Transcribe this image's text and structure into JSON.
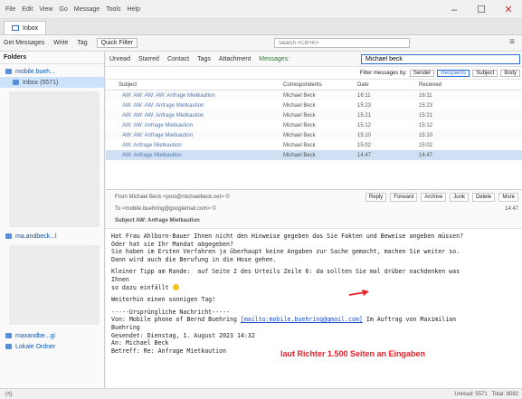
{
  "menu": [
    "File",
    "Edit",
    "View",
    "Go",
    "Message",
    "Tools",
    "Help"
  ],
  "tab": {
    "label": "Inbox"
  },
  "toolbar": {
    "get_messages": "Get Messages",
    "write": "Write",
    "tag": "Tag",
    "quick_filter": "Quick Filter",
    "search_placeholder": "Search <Ctrl+K>"
  },
  "sidebar": {
    "header": "Folders",
    "account1": "mobile.bueh...",
    "inbox": "Inbox (5571)",
    "account2": "ma.andbeck...l",
    "account3": "maxandbe...gi",
    "local": "Lokale Ordner"
  },
  "filterbar": {
    "unread": "Unread",
    "starred": "Starred",
    "contact": "Contact",
    "tags": "Tags",
    "attachment": "Attachment",
    "messages_label": "Messages:",
    "filter_value": "Michael beck",
    "filter_by": "Filter messages by:",
    "sender": "Sender",
    "recipients": "Recipients",
    "subject": "Subject",
    "body": "Body"
  },
  "columns": {
    "subject": "Subject",
    "correspondents": "Correspondents",
    "date": "Date",
    "received": "Received"
  },
  "messages": [
    {
      "subject": "AW: AW: AW: AW: Anfrage Mietkaution",
      "correspondent": "Michael Beck",
      "date": "16:11",
      "received": "16:11"
    },
    {
      "subject": "AW: AW: AW: Anfrage Mietkaution",
      "correspondent": "Michael Beck",
      "date": "15:23",
      "received": "15:23"
    },
    {
      "subject": "AW: AW: AW: Anfrage Mietkaution",
      "correspondent": "Michael Beck",
      "date": "15:21",
      "received": "15:21"
    },
    {
      "subject": "AW: AW: Anfrage Mietkaution",
      "correspondent": "Michael Beck",
      "date": "15:12",
      "received": "15:12"
    },
    {
      "subject": "AW: AW: Anfrage Mietkaution",
      "correspondent": "Michael Beck",
      "date": "15:10",
      "received": "15:10"
    },
    {
      "subject": "AW: Anfrage Mietkaution",
      "correspondent": "Michael Beck",
      "date": "15:02",
      "received": "15:02"
    },
    {
      "subject": "AW: Anfrage Mietkaution",
      "correspondent": "Michael Beck",
      "date": "14:47",
      "received": "14:47"
    }
  ],
  "preview": {
    "from": "From Michael Beck <post@michaelbeck.net> ©",
    "to": "To  <mobile.buehring@googlemail.com> ©",
    "subject": "Subject  AW: Anfrage Mietkaution",
    "date": "14:47",
    "reply": "Reply",
    "forward": "Forward",
    "archive": "Archive",
    "junk": "Junk",
    "delete": "Delete",
    "more": "More"
  },
  "body": {
    "line1": "Hat Frau Ahlborn-Bauer Ihnen nicht den Hinweise gegeben das Sie Fakten und Beweise angeben müssen?",
    "line2": "Oder hat sie Ihr Mandat abgegeben?",
    "line3": "Sie haben im Ersten Verfahren ja überhaupt keine Angaben zur Sache gemacht, machen Sie weiter so.",
    "line4": "Dann wird auch die Berufung in die Hose gehen.",
    "line5": "Kleiner Tipp am Rande:  auf Seite 2 des Urteils Zeile 6: da sollten Sie mal drüber nachdenken was",
    "line6": "Ihnen",
    "line7": "so dazu einfällt",
    "line8": "Weiterhin einen sonnigen Tag!",
    "line9": "-----Ursprüngliche Nachricht-----",
    "line10a": "Von: Mobile phone of Bernd Buehring ",
    "line10link": "[mailto:mobile.buehring@gmail.com]",
    "line10b": " Im Auftrag von Maximilian",
    "line11": "Buehring",
    "line12": "Gesendet: Dienstag, 1. August 2023 14:32",
    "line13": "An: Michael Beck",
    "line14": "Betreff: Re: Anfrage Mietkaution",
    "annotation": "laut Richter 1.500 Seiten an Eingaben"
  },
  "status": {
    "left": "(•|)",
    "unread": "Unread: 5571",
    "total": "Total: 8082"
  },
  "colors": {
    "annotation": "#e4232b",
    "link": "#1a4fc9",
    "selected_row": "#cfdff4"
  }
}
